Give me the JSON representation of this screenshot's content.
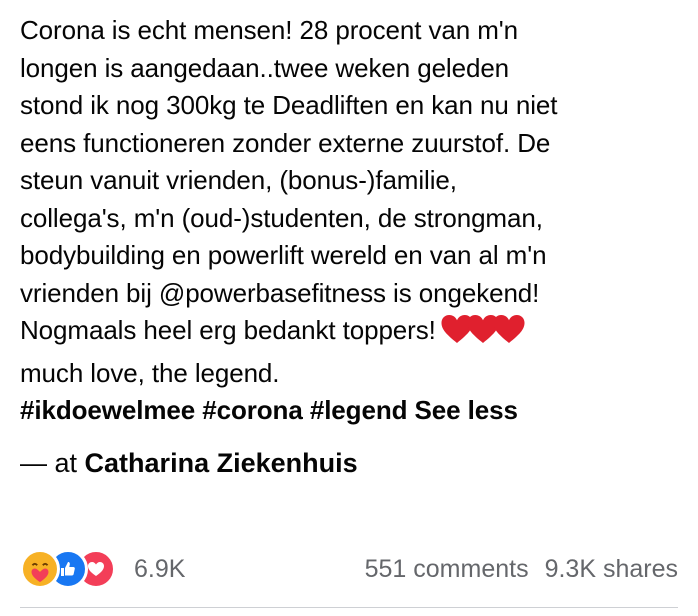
{
  "post": {
    "lines": [
      "Corona is echt mensen! 28 procent van m'n",
      "longen is aangedaan..twee weken geleden",
      "stond ik nog 300kg te Deadliften en kan nu niet",
      "eens functioneren zonder externe zuurstof. De",
      "steun vanuit vrienden, (bonus-)familie,",
      "collega's, m'n (oud-)studenten, de strongman,",
      "bodybuilding en powerlift wereld en van al m'n",
      "vrienden bij @powerbasefitness is ongekend!",
      "Nogmaals heel erg bedankt toppers!",
      "much love, the legend."
    ],
    "hashtags": [
      "#ikdoewelmee",
      "#corona",
      "#legend"
    ],
    "see_less": "See less",
    "location_prefix": "— at",
    "location_name": "Catharina Ziekenhuis"
  },
  "footer": {
    "reaction_icons": [
      "care-icon",
      "like-icon",
      "love-icon"
    ],
    "reaction_count": "6.9K",
    "comments": "551 comments",
    "shares": "9.3K shares"
  },
  "colors": {
    "text": "#050505",
    "meta_text": "#65676b",
    "like_blue": "#1877f2",
    "love_red": "#f33e58",
    "care_yellow": "#f7b125",
    "heart_red": "#e0202e",
    "divider": "#ced0d4"
  }
}
